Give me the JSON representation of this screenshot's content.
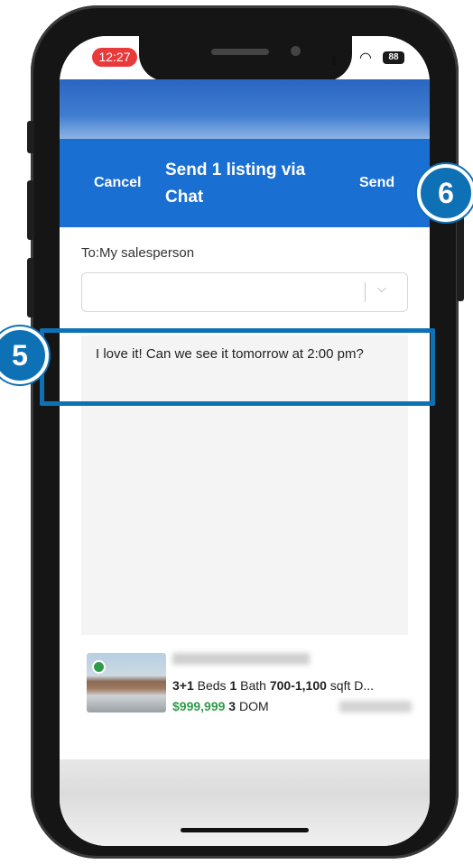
{
  "status_bar": {
    "time": "12:27",
    "battery": "88",
    "wifi_icon": "wifi-icon",
    "signal_icon": "signal-icon"
  },
  "modal": {
    "cancel_label": "Cancel",
    "title": "Send 1 listing via Chat",
    "send_label": "Send",
    "to_label": "To:My salesperson",
    "recipient_select": {
      "value": "",
      "chevron_icon": "chevron-down-icon"
    },
    "message_text": "I love it! Can we see it tomorrow at 2:00 pm?"
  },
  "listing": {
    "beds_value": "3+1",
    "beds_label": "Beds",
    "bath_value": "1",
    "bath_label": "Bath",
    "sqft_value": "700-1,100",
    "sqft_label": "sqft",
    "extra": "D...",
    "price": "$999,999",
    "dom_value": "3",
    "dom_label": "DOM"
  },
  "annotations": {
    "step_5": "5",
    "step_6": "6"
  },
  "colors": {
    "header_blue": "#1a6fd3",
    "annotation_blue": "#0f71b5",
    "price_green": "#2e9b4a",
    "time_pill_red": "#e83a3a"
  }
}
